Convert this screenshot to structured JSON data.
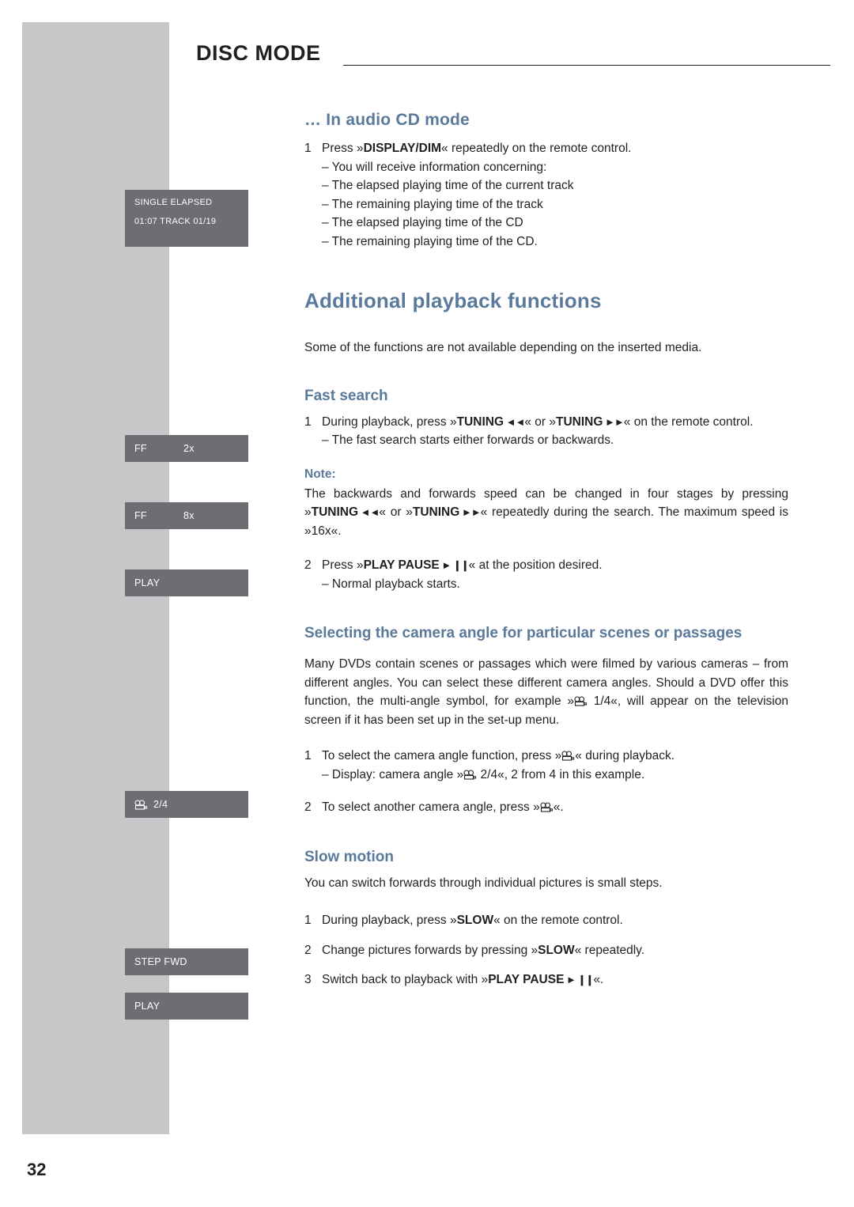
{
  "header": {
    "title": "DISC MODE"
  },
  "page_number": "32",
  "displays": [
    {
      "name": "single-elapsed-display",
      "line1": "SINGLE ELAPSED",
      "line2": "01:07  TRACK 01/19"
    },
    {
      "name": "ff-2x-display",
      "key": "FF",
      "value": "2x"
    },
    {
      "name": "ff-8x-display",
      "key": "FF",
      "value": "8x"
    },
    {
      "name": "play-display-1",
      "key": "PLAY",
      "value": ""
    },
    {
      "name": "angle-display",
      "key": "",
      "value": "2/4"
    },
    {
      "name": "step-fwd-display",
      "key": "STEP FWD",
      "value": ""
    },
    {
      "name": "play-display-2",
      "key": "PLAY",
      "value": ""
    }
  ],
  "sections": {
    "audio_cd": {
      "heading": "… In audio CD mode",
      "step1_num": "1",
      "step1_a": "Press »",
      "step1_b": "DISPLAY/DIM",
      "step1_c": "« repeatedly on the remote control.",
      "bullets": [
        "– You will receive information concerning:",
        "– The elapsed playing time of the current track",
        "– The remaining playing time of the track",
        "– The elapsed playing time of the CD",
        "– The remaining playing time of the CD."
      ]
    },
    "additional": {
      "title": "Additional playback functions",
      "intro": "Some of the functions are not available depending on the inserted media."
    },
    "fast_search": {
      "heading": "Fast search",
      "step1_num": "1",
      "step1_a": "During playback, press »",
      "step1_tuning1": "TUNING",
      "step1_b": "« or »",
      "step1_tuning2": "TUNING",
      "step1_c": "« on the remote control.",
      "result": "– The fast search starts either forwards or backwards.",
      "note_label": "Note:",
      "note_a": "The backwards and forwards speed can be changed in four stages by pressing »",
      "note_tuning1": "TUNING",
      "note_b": "« or »",
      "note_tuning2": "TUNING",
      "note_c": "« repeatedly during the search. The maximum speed is »16x«.",
      "step2_num": "2",
      "step2_a": "Press »",
      "step2_b": "PLAY PAUSE",
      "step2_c": "« at the position desired.",
      "step2_result": "– Normal playback starts."
    },
    "camera_angle": {
      "heading": "Selecting the camera angle for particular scenes or passages",
      "intro_a": "Many DVDs contain scenes or passages which were filmed by various cameras – from different angles. You can select these different camera angles. Should a DVD offer this function, the multi-angle symbol, for example »",
      "intro_b": " 1/4«, will appear on the television screen if it has been set up in the set-up menu.",
      "step1_num": "1",
      "step1_a": "To select the camera angle function, press »",
      "step1_b": "« during playback.",
      "step1_result_a": "– Display: camera angle »",
      "step1_result_b": " 2/4«, 2 from 4 in this example.",
      "step2_num": "2",
      "step2_a": "To select another camera angle, press »",
      "step2_b": "«."
    },
    "slow_motion": {
      "heading": "Slow motion",
      "intro": "You can switch forwards through individual pictures is small steps.",
      "step1_num": "1",
      "step1_a": "During playback, press »",
      "step1_b": "SLOW",
      "step1_c": "« on the remote control.",
      "step2_num": "2",
      "step2_a": "Change pictures forwards by pressing »",
      "step2_b": "SLOW",
      "step2_c": "« repeatedly.",
      "step3_num": "3",
      "step3_a": "Switch back to playback with »",
      "step3_b": "PLAY PAUSE",
      "step3_c": "«."
    }
  }
}
